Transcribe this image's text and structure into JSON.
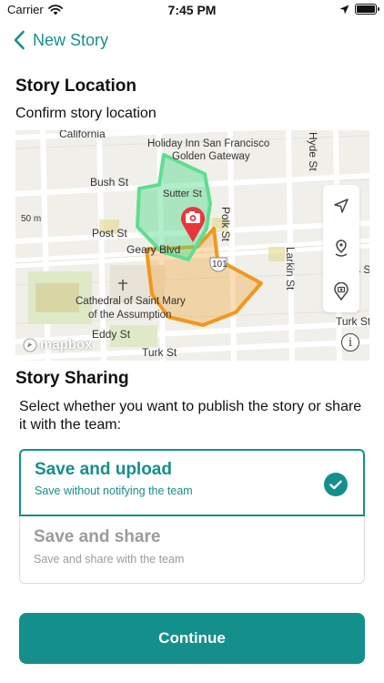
{
  "status_bar": {
    "carrier": "Carrier",
    "time": "7:45 PM"
  },
  "nav": {
    "back_label": "New Story"
  },
  "location": {
    "title": "Story Location",
    "subtitle": "Confirm story location"
  },
  "map": {
    "street_labels": [
      "California",
      "Holiday Inn San Francisco",
      "Golden Gateway",
      "Bush St",
      "Sutter St",
      "Post St",
      "Geary Blvd",
      "Polk St",
      "Hyde St",
      "Larkin St",
      "101",
      "Cathedral of Saint Mary",
      "of the Assumption",
      "Eddy St",
      "Turk St",
      "Turk St",
      "50 m",
      "s St"
    ],
    "logo_text": "mapbox",
    "controls": [
      "location-arrow-icon",
      "map-pin-icon",
      "camera-pin-icon"
    ],
    "colors": {
      "green_area": "#52d98b",
      "orange_area": "#f2a53f",
      "marker": "#e8363a"
    }
  },
  "sharing": {
    "title": "Story Sharing",
    "description": "Select whether you want to publish the story or share it with the team:",
    "options": [
      {
        "title": "Save and upload",
        "subtitle": "Save without notifying the team",
        "selected": true
      },
      {
        "title": "Save and share",
        "subtitle": "Save and share with the team",
        "selected": false
      }
    ]
  },
  "continue_label": "Continue",
  "accent_color": "#148f8c"
}
